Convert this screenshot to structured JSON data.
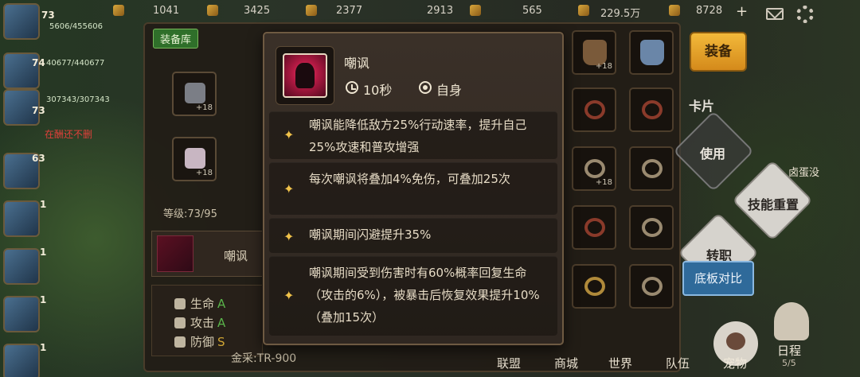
{
  "topbar": {
    "resources": [
      "1041",
      "3425",
      "2377",
      "2913",
      "565",
      "229.5万",
      "8728"
    ],
    "plus": "+"
  },
  "party": {
    "members": [
      {
        "level": "73",
        "hp": "5606/455606"
      },
      {
        "level": "74",
        "hp": "40677/440677"
      },
      {
        "level": "73",
        "hp": "307343/307343"
      },
      {
        "level": "63",
        "hp": ""
      },
      {
        "level": "1",
        "hp": ""
      },
      {
        "level": "1",
        "hp": ""
      },
      {
        "level": "1",
        "hp": ""
      },
      {
        "level": "1",
        "hp": ""
      }
    ],
    "note": "在酬还不删"
  },
  "equipment": {
    "tab_label": "装备库",
    "slot_plus": "+18",
    "level_label": "等级:73/95",
    "skill_label": "嘲讽",
    "stats": [
      {
        "name": "生命",
        "grade": "A"
      },
      {
        "name": "攻击",
        "grade": "A"
      },
      {
        "name": "防御",
        "grade": "S"
      }
    ],
    "gold": "金采:TR-900"
  },
  "right_panel": {
    "equip_button": "装备",
    "card_label": "卡片",
    "use_button": "使用",
    "reset_button": "技能重置",
    "transfer_button": "转职",
    "compare_button": "底板对比",
    "side_name": "卤蛋没",
    "schedule_label": "日程",
    "schedule_sub": "5/5",
    "pet_label": "宠物"
  },
  "bottom_nav": [
    "联盟",
    "商城",
    "世界",
    "队伍"
  ],
  "tooltip": {
    "skill_name": "嘲讽",
    "cooldown": "10秒",
    "target": "自身",
    "effects": [
      "嘲讽能降低敌方25%行动速率，提升自己25%攻速和普攻增强",
      "每次嘲讽将叠加4%免伤，可叠加25次",
      "嘲讽期间闪避提升35%",
      "嘲讽期间受到伤害时有60%概率回复生命（攻击的6%），被暴击后恢复效果提升10%（叠加15次）"
    ]
  },
  "colors": {
    "tooltip_bg": "#352c25",
    "tooltip_border": "#6e5a42",
    "star": "#f0c24a",
    "equip_button": "#e9a42c",
    "compare_button": "#2f6a9a"
  }
}
